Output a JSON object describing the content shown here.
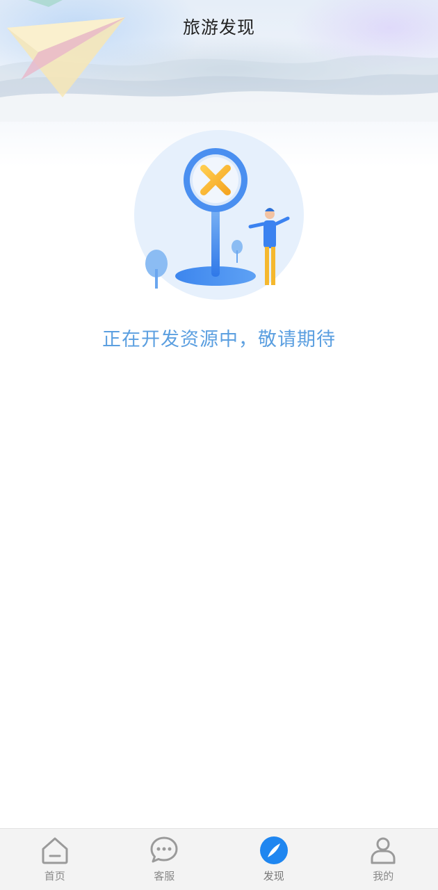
{
  "header": {
    "title": "旅游发现"
  },
  "main": {
    "illustration_icon": "under-development-sign-illustration",
    "message": "正在开发资源中，敬请期待"
  },
  "tabbar": {
    "active_index": 2,
    "accent_color": "#1f86f0",
    "items": [
      {
        "label": "首页",
        "icon": "home-icon"
      },
      {
        "label": "客服",
        "icon": "chat-bubble-icon"
      },
      {
        "label": "发现",
        "icon": "compass-icon"
      },
      {
        "label": "我的",
        "icon": "user-icon"
      }
    ]
  }
}
